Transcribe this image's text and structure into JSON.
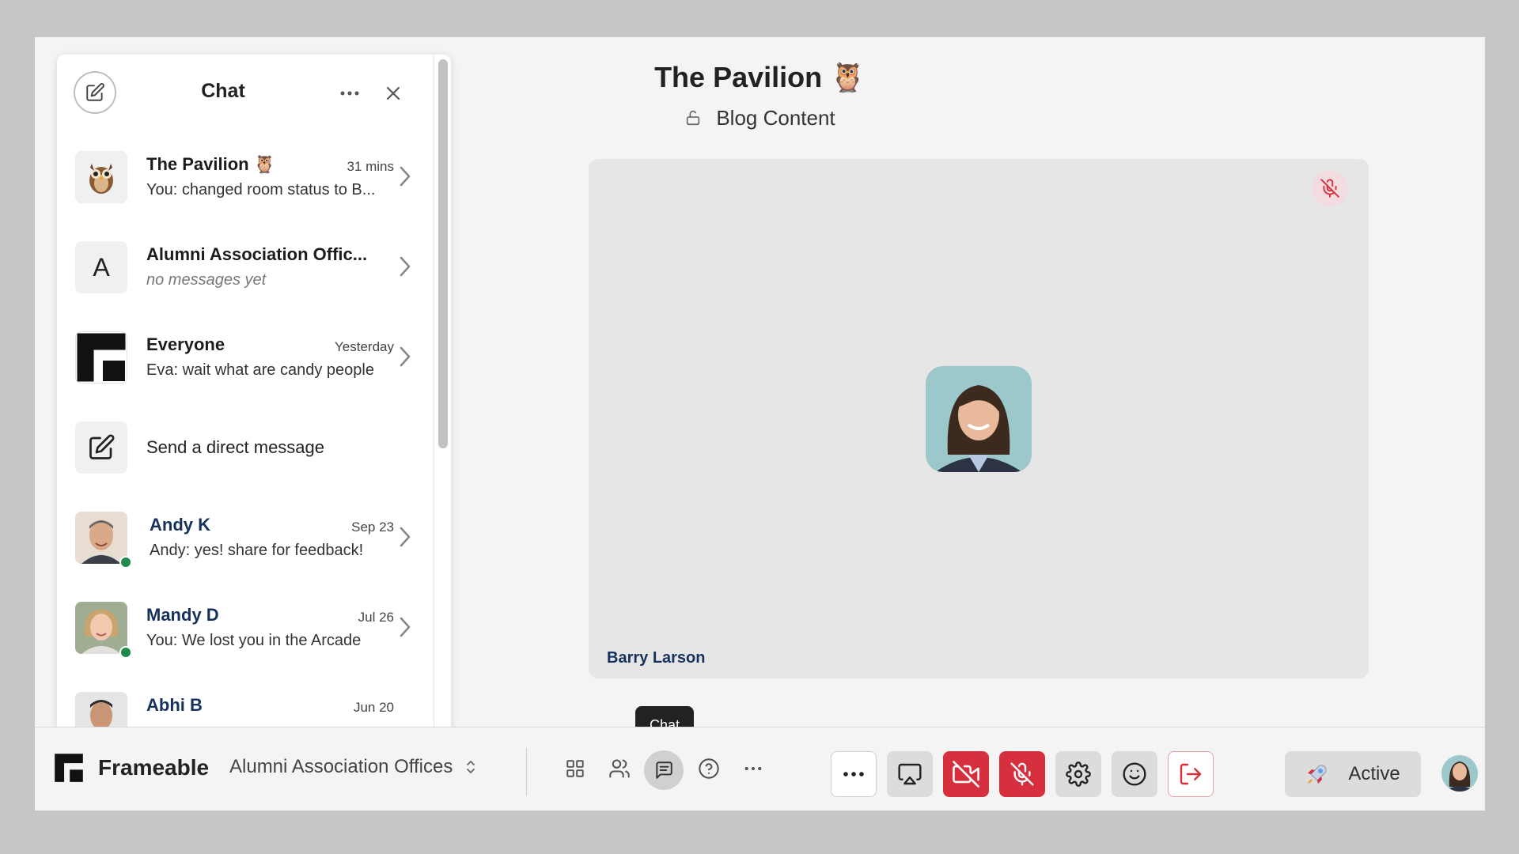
{
  "chat": {
    "title": "Chat",
    "conversations": [
      {
        "name": "The Pavilion 🦉",
        "time": "31 mins",
        "message": "You: changed room status to B...",
        "avatar": "owl"
      },
      {
        "name": "Alumni Association Offic...",
        "time": "",
        "message": "no messages yet",
        "avatar_letter": "A"
      },
      {
        "name": "Everyone",
        "time": "Yesterday",
        "message": "Eva: wait what are candy people",
        "avatar": "frameable-logo"
      },
      {
        "name": "Send a direct message",
        "avatar": "compose-icon"
      },
      {
        "name": "Andy K",
        "time": "Sep 23",
        "message": "Andy:  yes!  share for feedback!",
        "status": "online"
      },
      {
        "name": "Mandy D",
        "time": "Jul 26",
        "message": "You: We lost you in the Arcade",
        "status": "online"
      },
      {
        "name": "Abhi B",
        "time": "Jun 20"
      }
    ]
  },
  "room": {
    "title": "The Pavilion 🦉",
    "status": "Blog Content",
    "participant_name": "Barry Larson"
  },
  "tooltip": "Chat",
  "bottombar": {
    "brand": "Frameable",
    "current_room": "Alumni Association Offices",
    "status_label": "Active"
  },
  "colors": {
    "danger": "#d6303e",
    "online": "#1e8a4c",
    "name_blue": "#16325c"
  }
}
